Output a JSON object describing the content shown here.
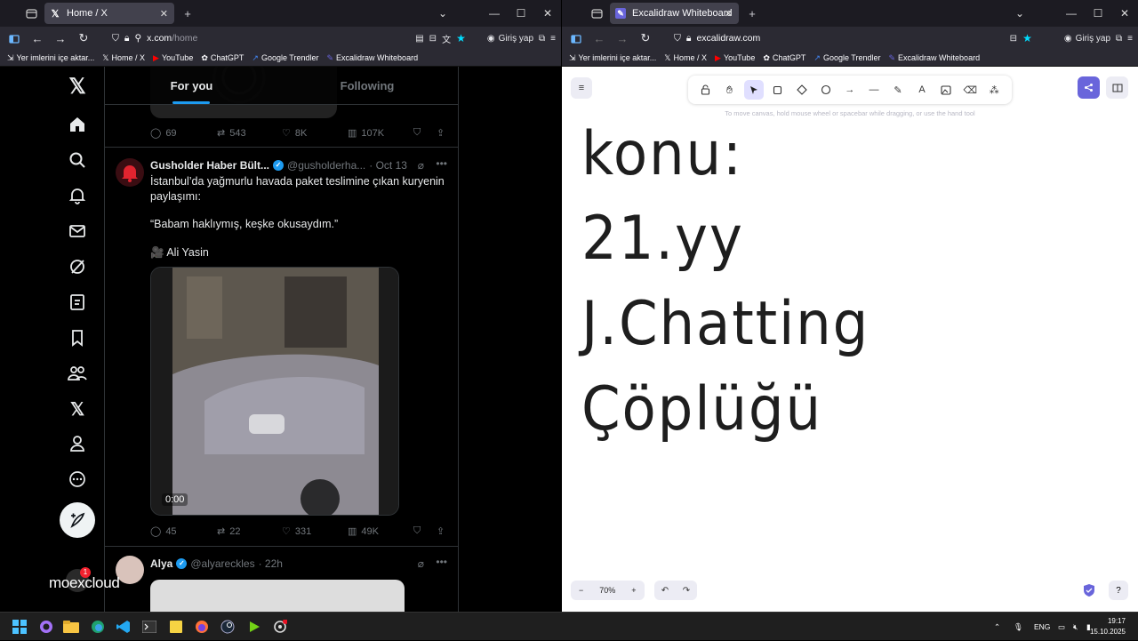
{
  "left_window": {
    "tab_title": "Home / X",
    "url_host": "x.com",
    "url_path": "/home",
    "login_label": "Giriş yap",
    "bookmarks": [
      "Yer imlerini içe aktar...",
      "Home / X",
      "YouTube",
      "ChatGPT",
      "Google Trendler",
      "Excalidraw Whiteboard"
    ]
  },
  "right_window": {
    "tab_title": "Excalidraw Whiteboard",
    "url": "excalidraw.com",
    "login_label": "Giriş yap",
    "bookmarks": [
      "Yer imlerini içe aktar...",
      "Home / X",
      "YouTube",
      "ChatGPT",
      "Google Trendler",
      "Excalidraw Whiteboard"
    ]
  },
  "x": {
    "tabs": [
      "For you",
      "Following"
    ],
    "top_stats": {
      "replies": "69",
      "reposts": "543",
      "likes": "8K",
      "views": "107K"
    },
    "tweet1": {
      "name": "Gusholder Haber Bült...",
      "handle": "@gusholderha...",
      "time": "· Oct 13",
      "line1": "İstanbul’da yağmurlu havada paket teslimine çıkan kuryenin paylaşımı:",
      "line2": "“Babam haklıymış, keşke okusaydım.”",
      "line3": "🎥 Ali Yasin",
      "video_time": "0:00",
      "stats": {
        "replies": "45",
        "reposts": "22",
        "likes": "331",
        "views": "49K"
      }
    },
    "tweet2": {
      "name": "Alya",
      "handle": "@alyareckles",
      "time": "· 22h"
    },
    "watermark": "moexcloud"
  },
  "excalidraw": {
    "hint": "To move canvas, hold mouse wheel or spacebar while dragging, or use the hand tool",
    "lines": [
      "konu:",
      "21.yy",
      "J.Chatting",
      "Çöplüğü"
    ],
    "zoom": "70%"
  },
  "taskbar": {
    "lang": "ENG",
    "time": "19:17",
    "date": "15.10.2025"
  },
  "colors": {
    "accent_blue": "#1d9bf0",
    "excalidraw_purple": "#6965db"
  }
}
